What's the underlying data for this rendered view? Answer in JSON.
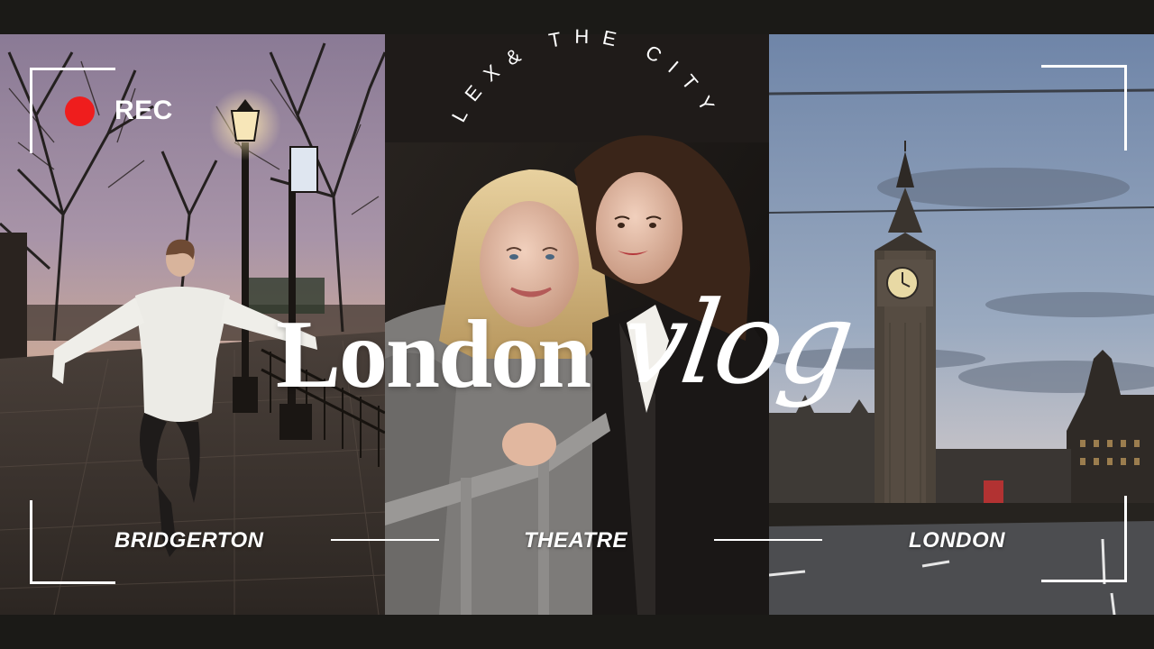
{
  "rec_label": "REC",
  "arc_title": "LEX& THE CITY",
  "title_main": "London",
  "title_script": "vlog",
  "captions": {
    "left": "BRIDGERTON",
    "center": "THEATRE",
    "right": "LONDON"
  },
  "colors": {
    "background": "#1b1a17",
    "rec_dot": "#ef1d1d",
    "text": "#ffffff"
  }
}
